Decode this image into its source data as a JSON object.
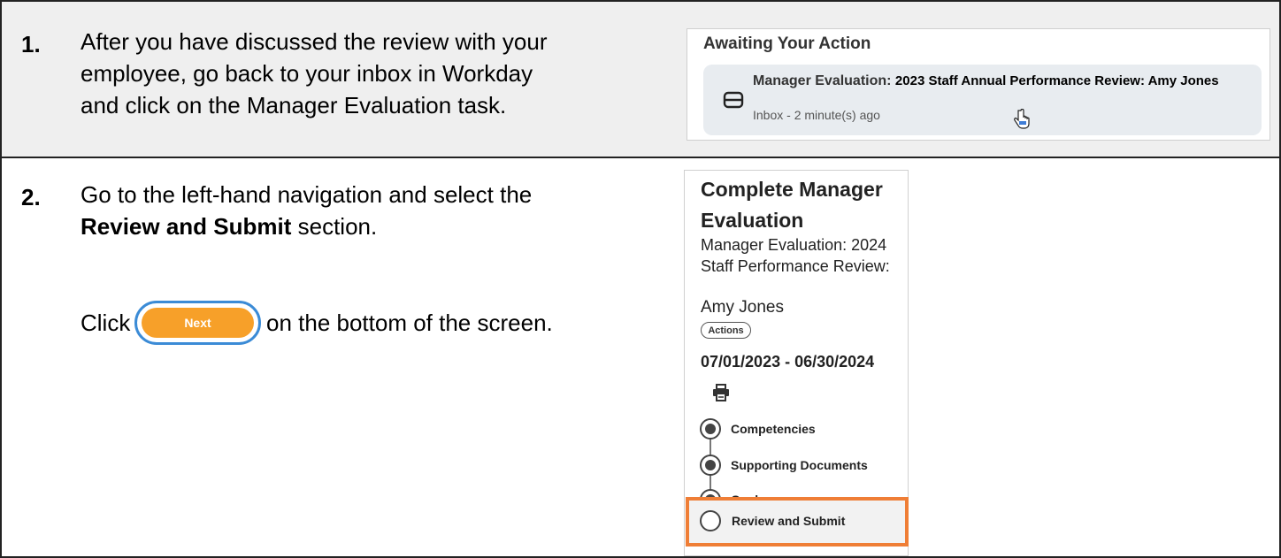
{
  "step1": {
    "number": "1.",
    "lines": [
      "After you have discussed the review with your",
      "employee, go back to your inbox in Workday",
      "and click on the Manager Evaluation task."
    ],
    "inbox": {
      "heading": "Awaiting Your Action",
      "item_title_part1": "Manager Evaluation: ",
      "item_title_part2": "2023 Staff Annual Performance Review: Amy Jones",
      "item_sub": "Inbox - 2 minute(s) ago",
      "icon": "inbox-tray-icon"
    }
  },
  "step2": {
    "number": "2.",
    "line1": "Go to the left-hand navigation and select the",
    "line2_bold": "Review and Submit",
    "line2_rest": " section.",
    "click_prefix": "Click",
    "next_label": "Next",
    "click_suffix": "on the bottom of the screen.",
    "nav": {
      "title_line1": "Complete Manager",
      "title_line2": "Evaluation",
      "sub_line1": "Manager Evaluation: 2024",
      "sub_line2": "Staff Performance Review:",
      "sub_line3": "Amy Jones",
      "actions_label": "Actions",
      "dates": "07/01/2023 - 06/30/2024",
      "steps": [
        {
          "label": "Competencies",
          "state": "complete"
        },
        {
          "label": "Supporting Documents",
          "state": "complete"
        },
        {
          "label": "Goals",
          "state": "complete"
        },
        {
          "label": "Review and Submit",
          "state": "current"
        }
      ]
    }
  },
  "colors": {
    "highlight": "#ef7e36",
    "next_button": "#f7a029",
    "next_ring": "#3b8bd6"
  }
}
